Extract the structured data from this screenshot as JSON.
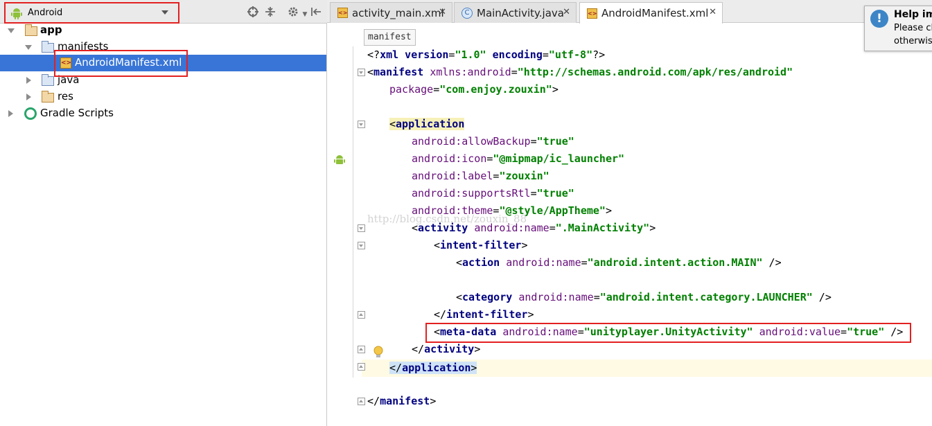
{
  "project_panel": {
    "view_selector": "Android",
    "tree": [
      {
        "label": "app"
      },
      {
        "label": "manifests"
      },
      {
        "label": "AndroidManifest.xml"
      },
      {
        "label": "java"
      },
      {
        "label": "res"
      },
      {
        "label": "Gradle Scripts"
      }
    ]
  },
  "editor": {
    "tabs": [
      {
        "label": "activity_main.xml",
        "active": false
      },
      {
        "label": "MainActivity.java",
        "active": false
      },
      {
        "label": "AndroidManifest.xml",
        "active": true
      }
    ],
    "breadcrumb": "manifest",
    "code": {
      "l1_a": "<?",
      "l1_b": "xml version",
      "l1_c": "=",
      "l1_d": "\"1.0\"",
      "l1_e": " encoding",
      "l1_f": "=",
      "l1_g": "\"utf-8\"",
      "l1_h": "?>",
      "l2_a": "<",
      "l2_b": "manifest ",
      "l2_c": "xmlns:android",
      "l2_d": "=",
      "l2_e": "\"http://schemas.android.com/apk/res/android\"",
      "l3_a": "package",
      "l3_b": "=",
      "l3_c": "\"com.enjoy.zouxin\"",
      "l3_d": ">",
      "l5_a": "<",
      "l5_b": "application",
      "l6_a": "android:allowBackup",
      "l6_b": "=",
      "l6_c": "\"true\"",
      "l7_a": "android:icon",
      "l7_b": "=",
      "l7_c": "\"@mipmap/ic_launcher\"",
      "l8_a": "android:label",
      "l8_b": "=",
      "l8_c": "\"zouxin\"",
      "l9_a": "android:supportsRtl",
      "l9_b": "=",
      "l9_c": "\"true\"",
      "l10_a": "android:theme",
      "l10_b": "=",
      "l10_c": "\"@style/AppTheme\"",
      "l10_d": ">",
      "l11_a": "<",
      "l11_b": "activity ",
      "l11_c": "android:name",
      "l11_d": "=",
      "l11_e": "\".MainActivity\"",
      "l11_f": ">",
      "l12_a": "<",
      "l12_b": "intent-filter",
      "l12_c": ">",
      "l13_a": "<",
      "l13_b": "action ",
      "l13_c": "android:name",
      "l13_d": "=",
      "l13_e": "\"android.intent.action.MAIN\"",
      "l13_f": " />",
      "l15_a": "<",
      "l15_b": "category ",
      "l15_c": "android:name",
      "l15_d": "=",
      "l15_e": "\"android.intent.category.LAUNCHER\"",
      "l15_f": " />",
      "l16_a": "</",
      "l16_b": "intent-filter",
      "l16_c": ">",
      "l17_a": "<",
      "l17_b": "meta-data ",
      "l17_c": "android:name",
      "l17_d": "=",
      "l17_e": "\"unityplayer.UnityActivity\"",
      "l17_f": " android:value",
      "l17_g": "=",
      "l17_h": "\"true\"",
      "l17_i": " />",
      "l18_a": "</",
      "l18_b": "activity",
      "l18_c": ">",
      "l19_a": "</",
      "l19_b": "application",
      "l19_c": ">",
      "l21_a": "</",
      "l21_b": "manifest",
      "l21_c": ">"
    },
    "watermark": "http://blog.csdn.net/zouxin_88"
  },
  "help_popup": {
    "title": "Help im",
    "line1": "Please cl",
    "line2": "otherwis"
  },
  "colors": {
    "selection": "#3875d7",
    "annotation_box": "#e32020",
    "tag": "#000080",
    "attribute": "#660e7a",
    "value": "#008000"
  }
}
